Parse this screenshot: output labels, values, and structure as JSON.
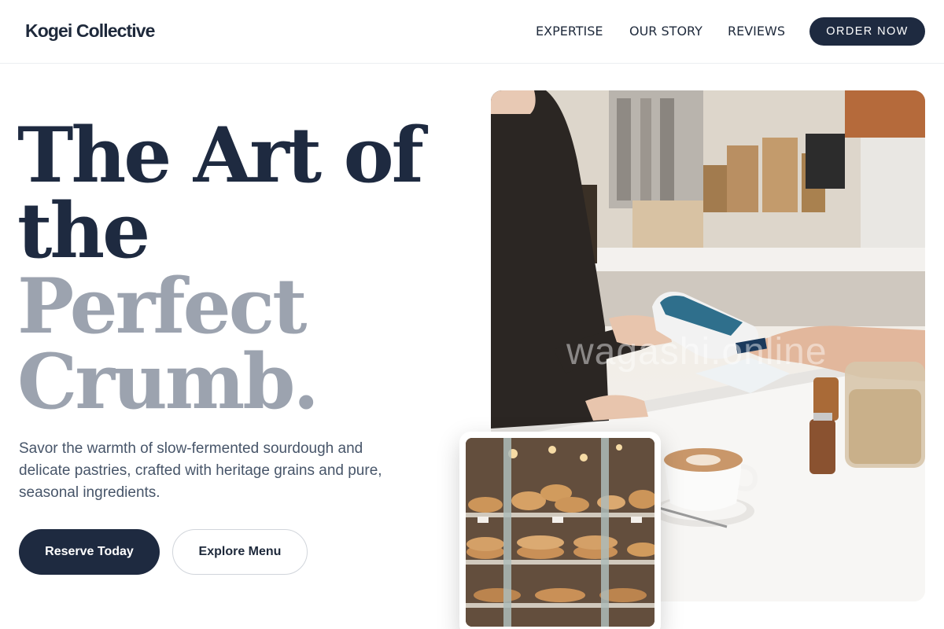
{
  "header": {
    "brand": "Kogei Collective",
    "nav": [
      {
        "label": "EXPERTISE"
      },
      {
        "label": "OUR STORY"
      },
      {
        "label": "REVIEWS"
      }
    ],
    "cta": "ORDER NOW"
  },
  "hero": {
    "headline_lines": [
      "The Art of",
      "the",
      "Perfect",
      "Crumb."
    ],
    "subtitle": "Savor the warmth of slow-fermented sourdough and delicate pastries, crafted with heritage grains and pure, seasonal ingredients.",
    "primary_button": "Reserve Today",
    "secondary_button": "Explore Menu"
  },
  "images": {
    "main": {
      "watermark": "wagashi.online"
    },
    "card": {}
  },
  "colors": {
    "navy": "#1e2a40",
    "muted_heading": "#9ca3af",
    "body_text": "#475569"
  }
}
